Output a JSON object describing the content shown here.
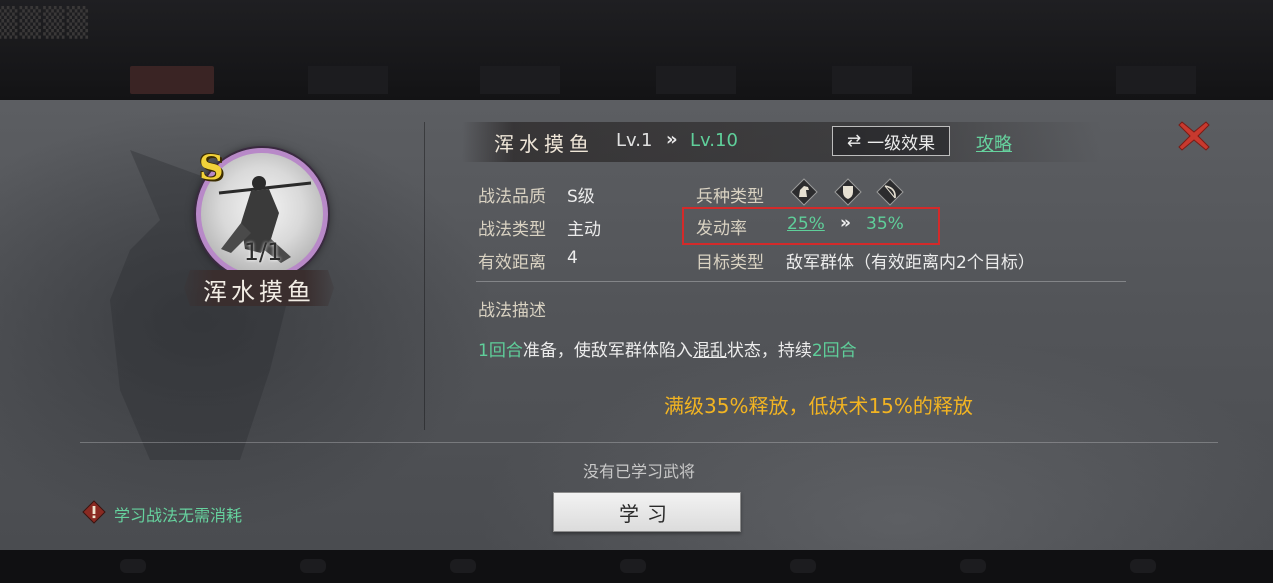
{
  "skill": {
    "name": "浑水摸鱼",
    "level_current": "Lv.1",
    "level_arrow": "»",
    "level_max": "Lv.10",
    "effect_button_icon": "⇄",
    "effect_button_label": "一级效果",
    "guide_label": "攻略"
  },
  "portrait": {
    "grade_badge": "S",
    "count": "1/1",
    "name": "浑水摸鱼"
  },
  "info": {
    "quality_label": "战法品质",
    "quality_value": "S级",
    "type_label": "战法类型",
    "type_value": "主动",
    "range_label": "有效距离",
    "range_value": "4",
    "troop_label": "兵种类型",
    "troop_icons": [
      "cavalry-icon",
      "shield-icon",
      "bow-icon"
    ],
    "rate_label": "发动率",
    "rate_current": "25%",
    "rate_arrow": "»",
    "rate_max": "35%",
    "target_label": "目标类型",
    "target_value": "敌军群体（有效距离内2个目标）"
  },
  "description": {
    "title": "战法描述",
    "part1": "1回合",
    "part2": "准备，使敌军群体陷入",
    "part3": "混乱",
    "part4": "状态，持续",
    "part5": "2回合"
  },
  "note": "满级35%释放，低妖术15%的释放",
  "footer": {
    "no_general": "没有已学习武将",
    "learn_button": "学习",
    "free_learn": "学习战法无需消耗"
  },
  "colors": {
    "accent_green": "#5fcf9a",
    "note_orange": "#f2b422",
    "highlight_red": "#d42a2a",
    "portrait_ring": "#b889c8"
  }
}
